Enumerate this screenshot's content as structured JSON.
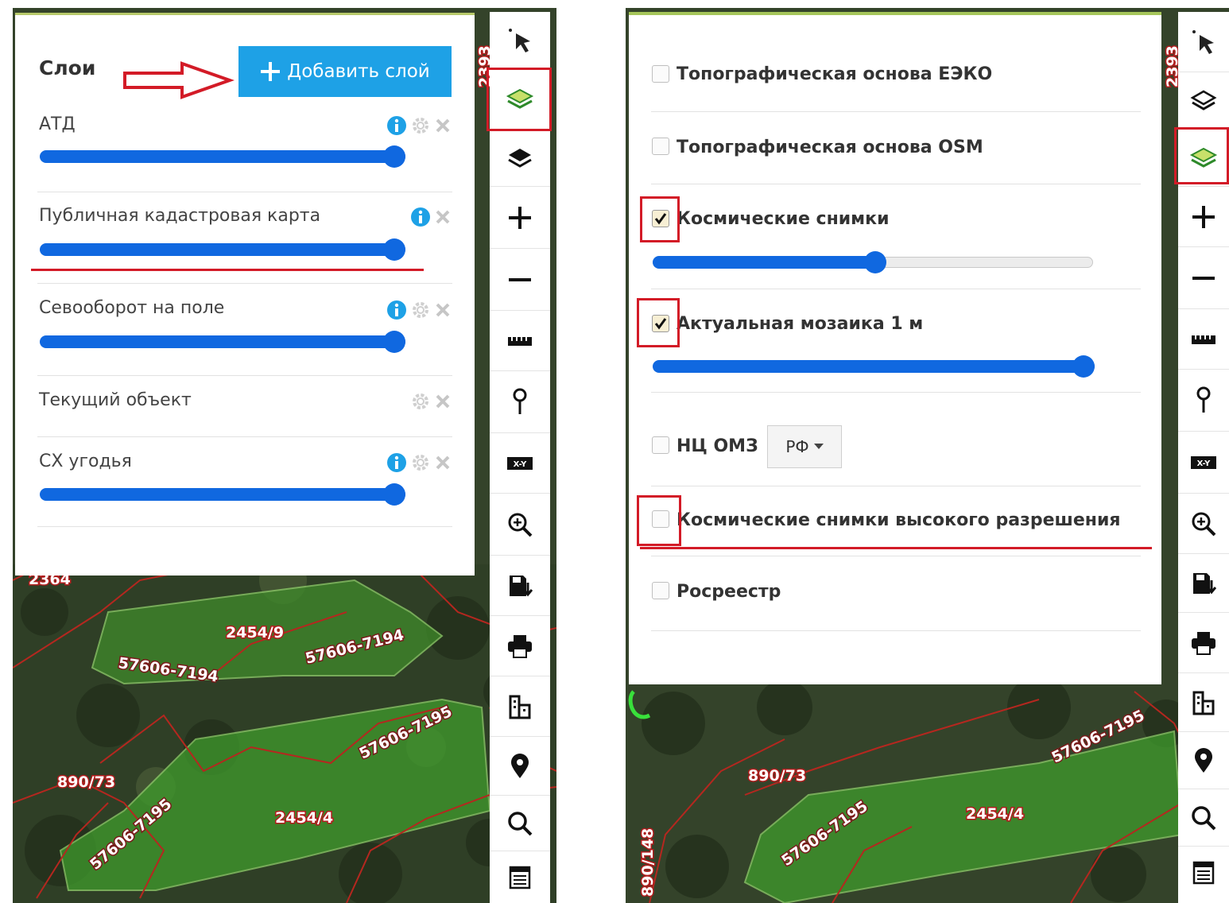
{
  "left": {
    "panel_title": "Слои",
    "add_layer_label": "Добавить слой",
    "layers": [
      {
        "name": "АТД",
        "opacity": 1.0
      },
      {
        "name": "Публичная кадастровая карта",
        "opacity": 1.0
      },
      {
        "name": "Севооборот на поле",
        "opacity": 1.0
      },
      {
        "name": "Текущий объект"
      },
      {
        "name": "СХ угодья",
        "opacity": 1.0
      }
    ],
    "map_labels": [
      "2454/9",
      "57606-7194",
      "57606-7194",
      "57606-7195",
      "890/73",
      "2454/4",
      "57606-7195",
      "2364",
      "2393"
    ]
  },
  "right": {
    "layers": [
      {
        "name": "Топографическая основа ЕЭКО",
        "checked": false
      },
      {
        "name": "Топографическая основа OSM",
        "checked": false
      },
      {
        "name": "Космические снимки",
        "checked": true,
        "opacity": 0.5
      },
      {
        "name": "Актуальная мозаика 1 м",
        "checked": true,
        "opacity": 1.0
      },
      {
        "name": "НЦ ОМЗ",
        "checked": false,
        "select_value": "РФ"
      },
      {
        "name": "Космические снимки высокого разрешения",
        "checked": false
      },
      {
        "name": "Росреестр",
        "checked": false
      }
    ],
    "map_labels": [
      "57606-7195",
      "890/73",
      "2454/4",
      "57606-7195",
      "890/148",
      "2393"
    ]
  },
  "toolbar_icons": [
    "select-arrow-icon",
    "layers-icon",
    "base-layers-icon",
    "zoom-in-icon",
    "zoom-out-icon",
    "ruler-icon",
    "pin-icon",
    "xy-coordinates-icon",
    "zoom-area-icon",
    "save-icon",
    "print-icon",
    "buildings-icon",
    "marker-icon",
    "search-icon",
    "list-icon"
  ],
  "colors": {
    "accent_blue": "#1ea1e6",
    "slider_blue": "#1068e0",
    "highlight_red": "#d31b27",
    "panel_top_border": "#a6c65a"
  }
}
